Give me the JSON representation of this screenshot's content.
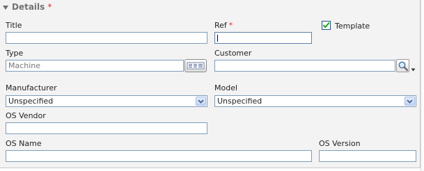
{
  "section": {
    "title": "Details",
    "required_mark": "*"
  },
  "fields": {
    "title": {
      "label": "Title",
      "value": ""
    },
    "ref": {
      "label": "Ref",
      "required_mark": "*",
      "value": ""
    },
    "template": {
      "label": "Template",
      "checked": true
    },
    "type": {
      "label": "Type",
      "placeholder": "Machine"
    },
    "customer": {
      "label": "Customer",
      "value": ""
    },
    "manufacturer": {
      "label": "Manufacturer",
      "selected": "Unspecified"
    },
    "model": {
      "label": "Model",
      "selected": "Unspecified"
    },
    "os_vendor": {
      "label": "OS Vendor",
      "value": ""
    },
    "os_name": {
      "label": "OS Name",
      "value": ""
    },
    "os_version": {
      "label": "OS Version",
      "value": ""
    }
  },
  "icons": {
    "section_toggle": "collapse-triangle-icon",
    "type_list": "list-icon",
    "customer_search": "magnifier-icon",
    "customer_dropdown": "small-down-arrow-icon",
    "select_arrow": "chevron-down-icon",
    "checkbox_mark": "checkmark-icon"
  },
  "colors": {
    "required": "#e0282e",
    "input_border": "#7f9db9",
    "checkmark": "#1fa31f"
  }
}
